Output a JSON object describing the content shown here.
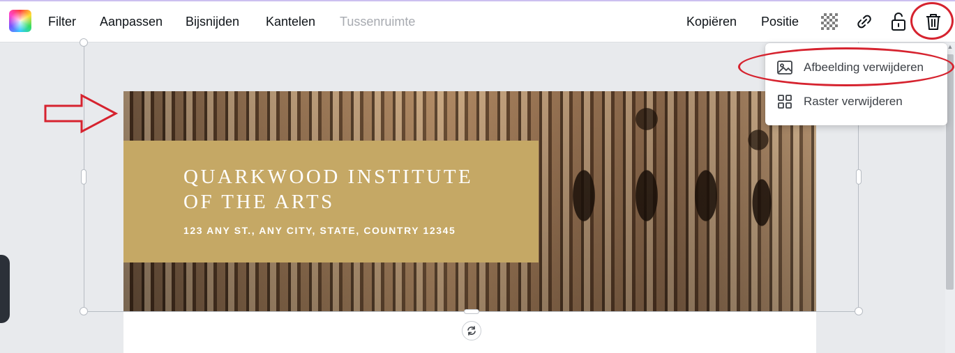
{
  "toolbar": {
    "items": [
      {
        "label": "Filter"
      },
      {
        "label": "Aanpassen"
      },
      {
        "label": "Bijsnijden"
      },
      {
        "label": "Kantelen"
      },
      {
        "label": "Tussenruimte"
      }
    ],
    "right_items": [
      {
        "label": "Kopiëren"
      },
      {
        "label": "Positie"
      }
    ],
    "icons": [
      "color-picker-icon",
      "transparency-icon",
      "link-icon",
      "lock-icon",
      "trash-icon"
    ]
  },
  "dropdown": {
    "items": [
      {
        "label": "Afbeelding verwijderen",
        "icon": "image-icon"
      },
      {
        "label": "Raster verwijderen",
        "icon": "grid-icon"
      }
    ]
  },
  "design": {
    "title": "QUARKWOOD INSTITUTE\nOF THE ARTS",
    "address": "123 ANY ST., ANY CITY, STATE, COUNTRY 12345"
  },
  "colors": {
    "annotation_red": "#d6232f",
    "gold": "#c5a865",
    "accent": "#6e48d4"
  }
}
